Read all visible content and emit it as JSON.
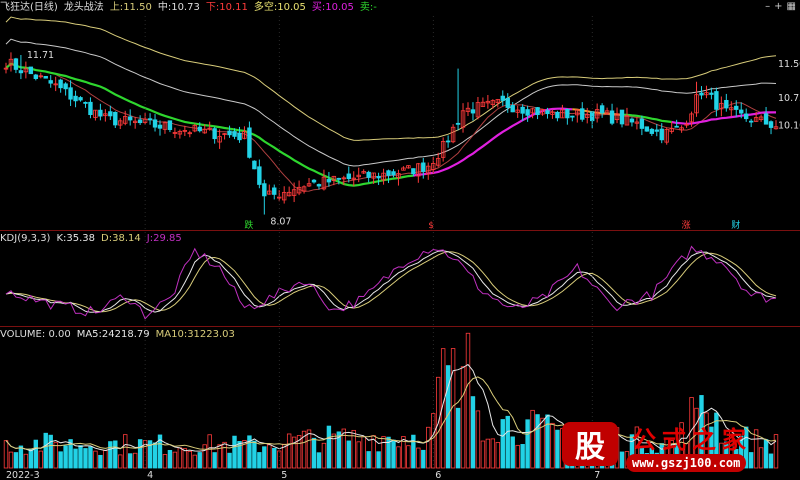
{
  "colors": {
    "up": "#ff3b3b",
    "down": "#22d2e6",
    "ma_green": "#2ed62e",
    "ma_magenta": "#e020e0",
    "ma_orange": "#e8a030",
    "band": "#d8cc7a",
    "band2": "#c9c9c9",
    "mid": "#b04040",
    "k": "#e6e6e6",
    "d": "#d8cc7a",
    "j": "#c030c0",
    "bg": "#000000",
    "sep": "#7a1010"
  },
  "main": {
    "title": "飞狂达(日线)",
    "indicator": "龙头战法",
    "upper_label": "上:",
    "upper_value": "11.50",
    "mid_label": "中:",
    "mid_value": "10.73",
    "lower_label": "下:",
    "lower_value": "10.11",
    "ls_label": "多空:",
    "ls_value": "10.05",
    "buy_label": "买:",
    "buy_value": "10.05",
    "sell_label": "卖:",
    "sell_value": "-",
    "y_labels": [
      "11.50",
      "10.73",
      "10.10"
    ],
    "hi_label": "11.71",
    "lo_label": "8.07",
    "markers": [
      {
        "text": "跌",
        "i": 49,
        "color": "#2ed62e"
      },
      {
        "text": "$",
        "i": 86,
        "color": "#ff3b3b"
      },
      {
        "text": "涨",
        "i": 137,
        "color": "#ff3b3b"
      },
      {
        "text": "财",
        "i": 147,
        "color": "#22d2e6"
      }
    ]
  },
  "kdj": {
    "title": "KDJ(9,3,3)",
    "k_label": "K:",
    "k": "35.38",
    "d_label": "D:",
    "d": "38.14",
    "j_label": "J:",
    "j": "29.85"
  },
  "volume": {
    "title": "VOLUME:",
    "value": "0.00",
    "ma5_label": "MA5:",
    "ma5": "24218.79",
    "ma10_label": "MA10:",
    "ma10": "31223.03"
  },
  "x_axis": {
    "labels": [
      "2022-3",
      "4",
      "5",
      "6",
      "7"
    ]
  },
  "corner_icons": [
    "minus-icon",
    "plus-icon",
    "grid-icon"
  ],
  "logo": {
    "glyph": "股",
    "name": "公式之家",
    "url": "www.gszj100.com"
  },
  "chart_data": [
    {
      "type": "candlestick",
      "title": "龙头战法",
      "series": [
        {
          "name": "上",
          "last": 11.5
        },
        {
          "name": "中",
          "last": 10.73
        },
        {
          "name": "下",
          "last": 10.11
        },
        {
          "name": "多空",
          "last": 10.05
        }
      ],
      "high": 11.71,
      "low": 8.07,
      "ylim": [
        7.9,
        12.6
      ]
    },
    {
      "type": "line",
      "title": "KDJ(9,3,3)",
      "series": [
        {
          "name": "K",
          "last": 35.38
        },
        {
          "name": "D",
          "last": 38.14
        },
        {
          "name": "J",
          "last": 29.85
        }
      ]
    },
    {
      "type": "bar",
      "title": "VOLUME",
      "series": [
        {
          "name": "VOLUME",
          "last": 0.0
        },
        {
          "name": "MA5",
          "last": 24218.79
        },
        {
          "name": "MA10",
          "last": 31223.03
        }
      ]
    }
  ]
}
